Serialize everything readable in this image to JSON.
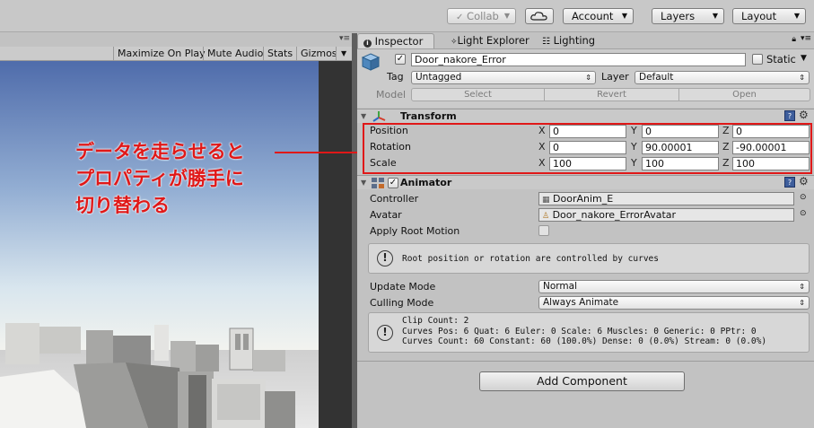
{
  "toolbar": {
    "collab": "Collab",
    "account": "Account",
    "layers": "Layers",
    "layout": "Layout"
  },
  "scene_bar": {
    "maximize": "Maximize On Play",
    "mute": "Mute Audio",
    "stats": "Stats",
    "gizmos": "Gizmos"
  },
  "inspector": {
    "tabs": [
      "Inspector",
      "Light Explorer",
      "Lighting"
    ],
    "object_name": "Door_nakore_Error",
    "static_label": "Static",
    "tag_label": "Tag",
    "tag_value": "Untagged",
    "layer_label": "Layer",
    "layer_value": "Default",
    "model_label": "Model",
    "model_buttons": [
      "Select",
      "Revert",
      "Open"
    ],
    "transform": {
      "title": "Transform",
      "rows": [
        {
          "label": "Position",
          "x": "0",
          "y": "0",
          "z": "0"
        },
        {
          "label": "Rotation",
          "x": "0",
          "y": "90.00001",
          "z": "-90.00001"
        },
        {
          "label": "Scale",
          "x": "100",
          "y": "100",
          "z": "100"
        }
      ]
    },
    "animator": {
      "title": "Animator",
      "controller_label": "Controller",
      "controller_value": "DoorAnim_E",
      "avatar_label": "Avatar",
      "avatar_value": "Door_nakore_ErrorAvatar",
      "root_motion_label": "Apply Root Motion",
      "root_motion_info": "Root position or rotation are controlled by curves",
      "update_mode_label": "Update Mode",
      "update_mode_value": "Normal",
      "culling_mode_label": "Culling Mode",
      "culling_mode_value": "Always Animate",
      "clip_info": [
        "Clip Count: 2",
        "Curves Pos: 6 Quat: 6 Euler: 0 Scale: 6 Muscles: 0 Generic: 0 PPtr: 0",
        "Curves Count: 60 Constant: 60 (100.0%) Dense: 0 (0.0%) Stream: 0 (0.0%)"
      ]
    },
    "add_component": "Add Component"
  },
  "annotation": {
    "lines": [
      "データを走らせると",
      "プロパティが勝手に",
      "切り替わる"
    ],
    "color": "#e01818"
  },
  "colors": {
    "panel": "#c2c2c2",
    "sky_top": "#4f6cab",
    "highlight": "#e01818"
  }
}
